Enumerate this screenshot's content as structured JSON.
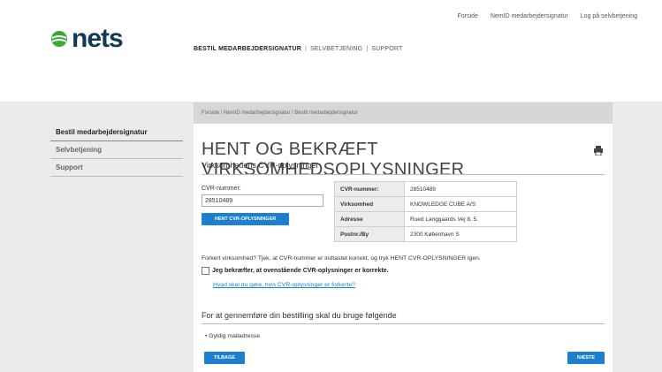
{
  "brand": {
    "name": "nets"
  },
  "top_links": [
    "Forside",
    "NemID medarbejdersignatur",
    "Log på selvbetjening"
  ],
  "main_nav": {
    "active": "BESTIL MEDARBEJDERSIGNATUR",
    "items": [
      "SELVBETJENING",
      "SUPPORT"
    ],
    "separator": "|"
  },
  "sidebar": {
    "items": [
      "Bestil medarbejdersignatur",
      "Selvbetjening",
      "Support"
    ]
  },
  "breadcrumb": "Forside / NemID medarbejdersignatur / Bestil medarbejdersignatur",
  "page": {
    "title": "HENT OG BEKRÆFT VIRKSOMHEDSOPLYSNINGER",
    "subtitle": "Virksomhedens CVR-oplysninger",
    "cvr_label": "CVR-nummer:",
    "cvr_value": "28510489",
    "fetch_button": "HENT CVR-OPLYSNINGER",
    "info_rows": [
      {
        "key": "CVR-nummer:",
        "value": "28510489"
      },
      {
        "key": "Virksomhed",
        "value": "KNOWLEDGE CUBE A/S"
      },
      {
        "key": "Adresse",
        "value": "Rued Langgaards Vej 8, 5."
      },
      {
        "key": "Postnr./By",
        "value": "2300 København S"
      }
    ],
    "wrong_text": "Forkert virksomhed? Tjek, at CVR-nummer er indtastet korrekt, og tryk HENT CVR-OPLYSNINGER igen.",
    "confirm_text": "Jeg bekræfter, at ovenstående CVR-oplysninger er korrekte.",
    "help_link": "Hvad skal du gøre, hvis CVR-oplysninger er forkerte?",
    "section2_title": "For at gennemføre din bestilling skal du bruge følgende",
    "bullet": "Gyldig mailadresse",
    "back_button": "TILBAGE",
    "next_button": "NÆSTE"
  },
  "colors": {
    "accent": "#1d7fce",
    "brand_green": "#3aaa35",
    "brand_navy": "#0e3a57"
  }
}
